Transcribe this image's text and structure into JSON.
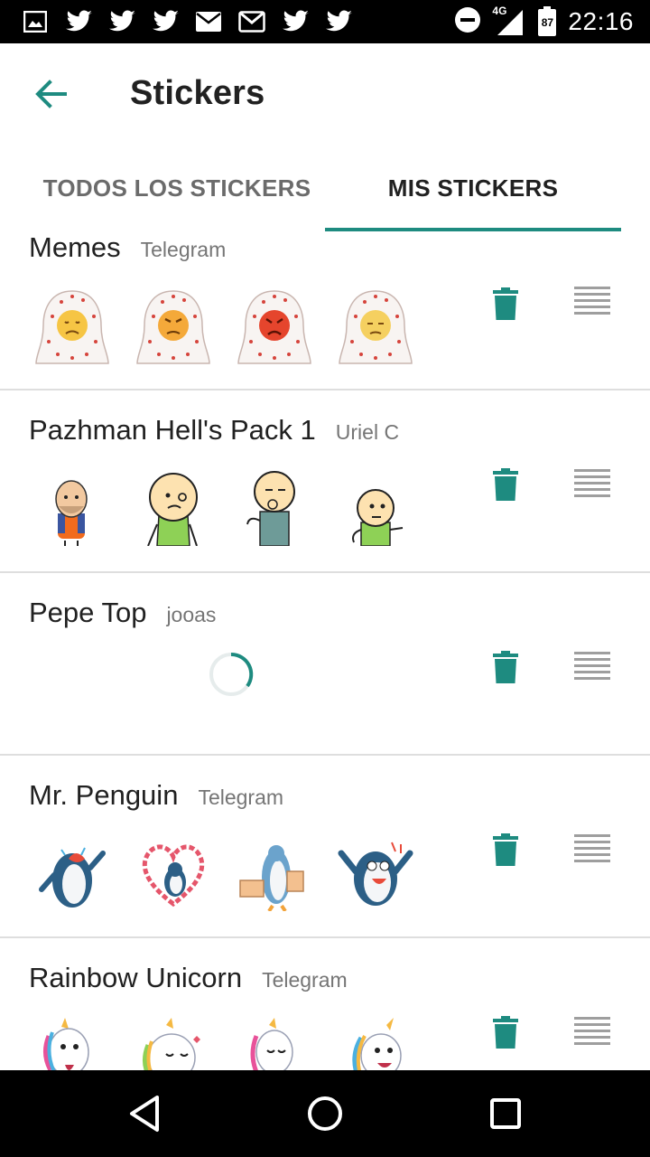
{
  "status_bar": {
    "time": "22:16",
    "network": "4G",
    "battery": "87",
    "notification_icons": [
      "gallery-icon",
      "twitter-icon",
      "twitter-icon",
      "twitter-icon",
      "mail-icon",
      "gmail-icon",
      "twitter-icon",
      "twitter-icon"
    ],
    "system_icons": [
      "do-not-disturb-icon",
      "signal-icon",
      "battery-icon"
    ]
  },
  "app_bar": {
    "title": "Stickers",
    "back_icon": "arrow-back-icon"
  },
  "tabs": [
    {
      "label": "TODOS LOS STICKERS",
      "active": false
    },
    {
      "label": "MIS STICKERS",
      "active": true
    }
  ],
  "packs": [
    {
      "name": "Memes",
      "author": "Telegram",
      "loading": false,
      "stickers": [
        "sad-blanket-sticker",
        "angry-blanket-sticker",
        "furious-blanket-sticker",
        "tired-blanket-sticker"
      ]
    },
    {
      "name": "Pazhman Hell's Pack 1",
      "author": "Uriel C",
      "loading": false,
      "stickers": [
        "bald-man-sticker",
        "worried-cartoon-sticker",
        "thinking-cartoon-sticker",
        "smug-cartoon-sticker"
      ]
    },
    {
      "name": "Pepe Top",
      "author": "jooas",
      "loading": true,
      "stickers": []
    },
    {
      "name": "Mr. Penguin",
      "author": "Telegram",
      "loading": false,
      "stickers": [
        "crying-penguin-sticker",
        "heart-penguin-sticker",
        "thumbs-up-penguin-sticker",
        "shocked-penguin-sticker"
      ]
    },
    {
      "name": "Rainbow Unicorn",
      "author": "Telegram",
      "loading": false,
      "stickers": [
        "unicorn-tongue-sticker",
        "unicorn-hug-sticker",
        "unicorn-thumbs-sticker",
        "unicorn-laugh-sticker"
      ]
    }
  ],
  "colors": {
    "accent": "#1e8b80",
    "divider": "#dedede",
    "text_primary": "#212121",
    "text_secondary": "#757575",
    "drag_handle": "#9e9e9e"
  },
  "nav_bar": {
    "buttons": [
      "back-triangle-icon",
      "home-circle-icon",
      "recents-square-icon"
    ]
  }
}
